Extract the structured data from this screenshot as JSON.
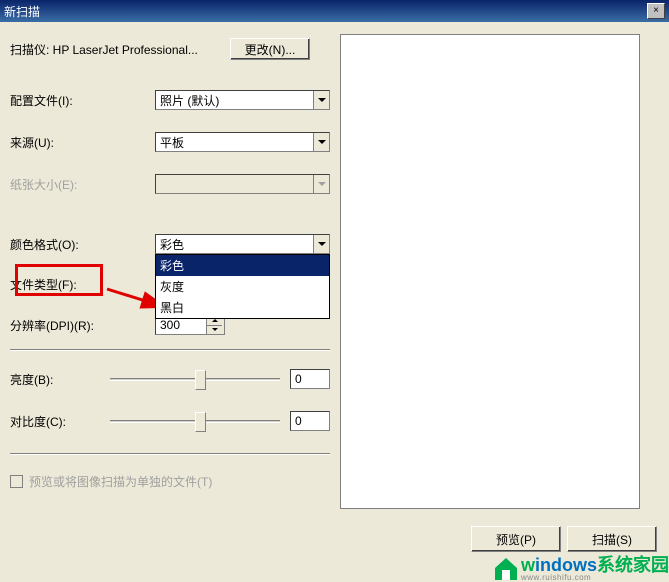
{
  "titlebar": {
    "title": "新扫描",
    "close": "×"
  },
  "scanner": {
    "prefix": "扫描仪: ",
    "name": "HP LaserJet Professional...",
    "change_btn": "更改(N)..."
  },
  "profile": {
    "label": "配置文件(I):",
    "value": "照片 (默认)"
  },
  "source": {
    "label": "来源(U):",
    "value": "平板"
  },
  "paper_size": {
    "label": "纸张大小(E):",
    "value": ""
  },
  "color_format": {
    "label": "颜色格式(O):",
    "value": "彩色",
    "options": [
      "彩色",
      "灰度",
      "黑白"
    ],
    "selected_index": 0
  },
  "file_type": {
    "label": "文件类型(F):"
  },
  "dpi": {
    "label": "分辨率(DPI)(R):",
    "value": "300"
  },
  "brightness": {
    "label": "亮度(B):",
    "value": "0",
    "percent": 50
  },
  "contrast": {
    "label": "对比度(C):",
    "value": "0",
    "percent": 50
  },
  "separate_files": {
    "label": "预览或将图像扫描为单独的文件(T)"
  },
  "buttons": {
    "preview": "预览(P)",
    "scan": "扫描(S)"
  },
  "watermark": {
    "main1": "w",
    "main2": "indows",
    "main3": "系统家园",
    "sub": "www.ruishifu.com"
  }
}
